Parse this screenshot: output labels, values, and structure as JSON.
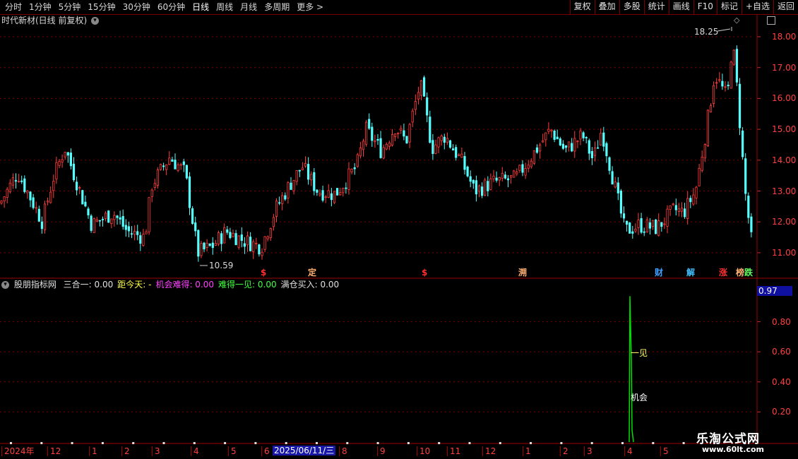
{
  "toolbar": {
    "tabs": [
      "分时",
      "1分钟",
      "5分钟",
      "15分钟",
      "30分钟",
      "60分钟",
      "日线",
      "周线",
      "月线",
      "多周期",
      "更多 >"
    ],
    "active_tab": 6,
    "buttons": [
      "复权",
      "叠加",
      "多股",
      "统计",
      "画线",
      "F10",
      "标记",
      "+自选",
      "返回"
    ]
  },
  "main_chart": {
    "title": "时代新材(日线 前复权)",
    "high_label": "18.25",
    "low_label": "10.59",
    "price_ticks": [
      "18.00",
      "17.00",
      "16.00",
      "15.00",
      "14.00",
      "13.00",
      "12.00",
      "11.00"
    ],
    "event_markers": [
      {
        "text": "$",
        "color": "#ff3030"
      },
      {
        "text": "定",
        "color": "#ffb070"
      },
      {
        "text": "$",
        "color": "#ff3030"
      },
      {
        "text": "溯",
        "color": "#ffb070"
      },
      {
        "text": "财",
        "color": "#40a0ff"
      },
      {
        "text": "解",
        "color": "#40c0ff"
      },
      {
        "text": "涨",
        "color": "#ff3030"
      },
      {
        "text": "榜",
        "color": "#ffb070"
      },
      {
        "text": "跌",
        "color": "#60ff60"
      }
    ]
  },
  "indicator_panel": {
    "name": "股朋指标网",
    "fields": [
      {
        "label": "三合一: 0.00",
        "color": "#e0e0e0"
      },
      {
        "label": "距今天: -",
        "color": "#ffff40"
      },
      {
        "label": "机会难得: 0.00",
        "color": "#ff40ff"
      },
      {
        "label": "难得一见: 0.00",
        "color": "#40ff40"
      },
      {
        "label": "满仓买入: 0.00",
        "color": "#e0e0e0"
      }
    ],
    "current_value": "0.97",
    "ticks": [
      "0.80",
      "0.60",
      "0.40",
      "0.20"
    ],
    "annotation_1": "一见",
    "annotation_2": "机会"
  },
  "time_axis": {
    "labels": [
      "2024年",
      "12",
      "1",
      "2",
      "3",
      "4",
      "5",
      "6",
      "8",
      "9",
      "10",
      "11",
      "12",
      "1",
      "2",
      "3",
      "4",
      "5"
    ],
    "highlight_label": "2025/06/11/三"
  },
  "watermark": {
    "title": "乐淘公式网",
    "url": "www.60lt.com"
  },
  "colors": {
    "up": "#ff3c3c",
    "down": "#54ffff",
    "grid": "#7a0000",
    "signal": "#00e000"
  }
}
